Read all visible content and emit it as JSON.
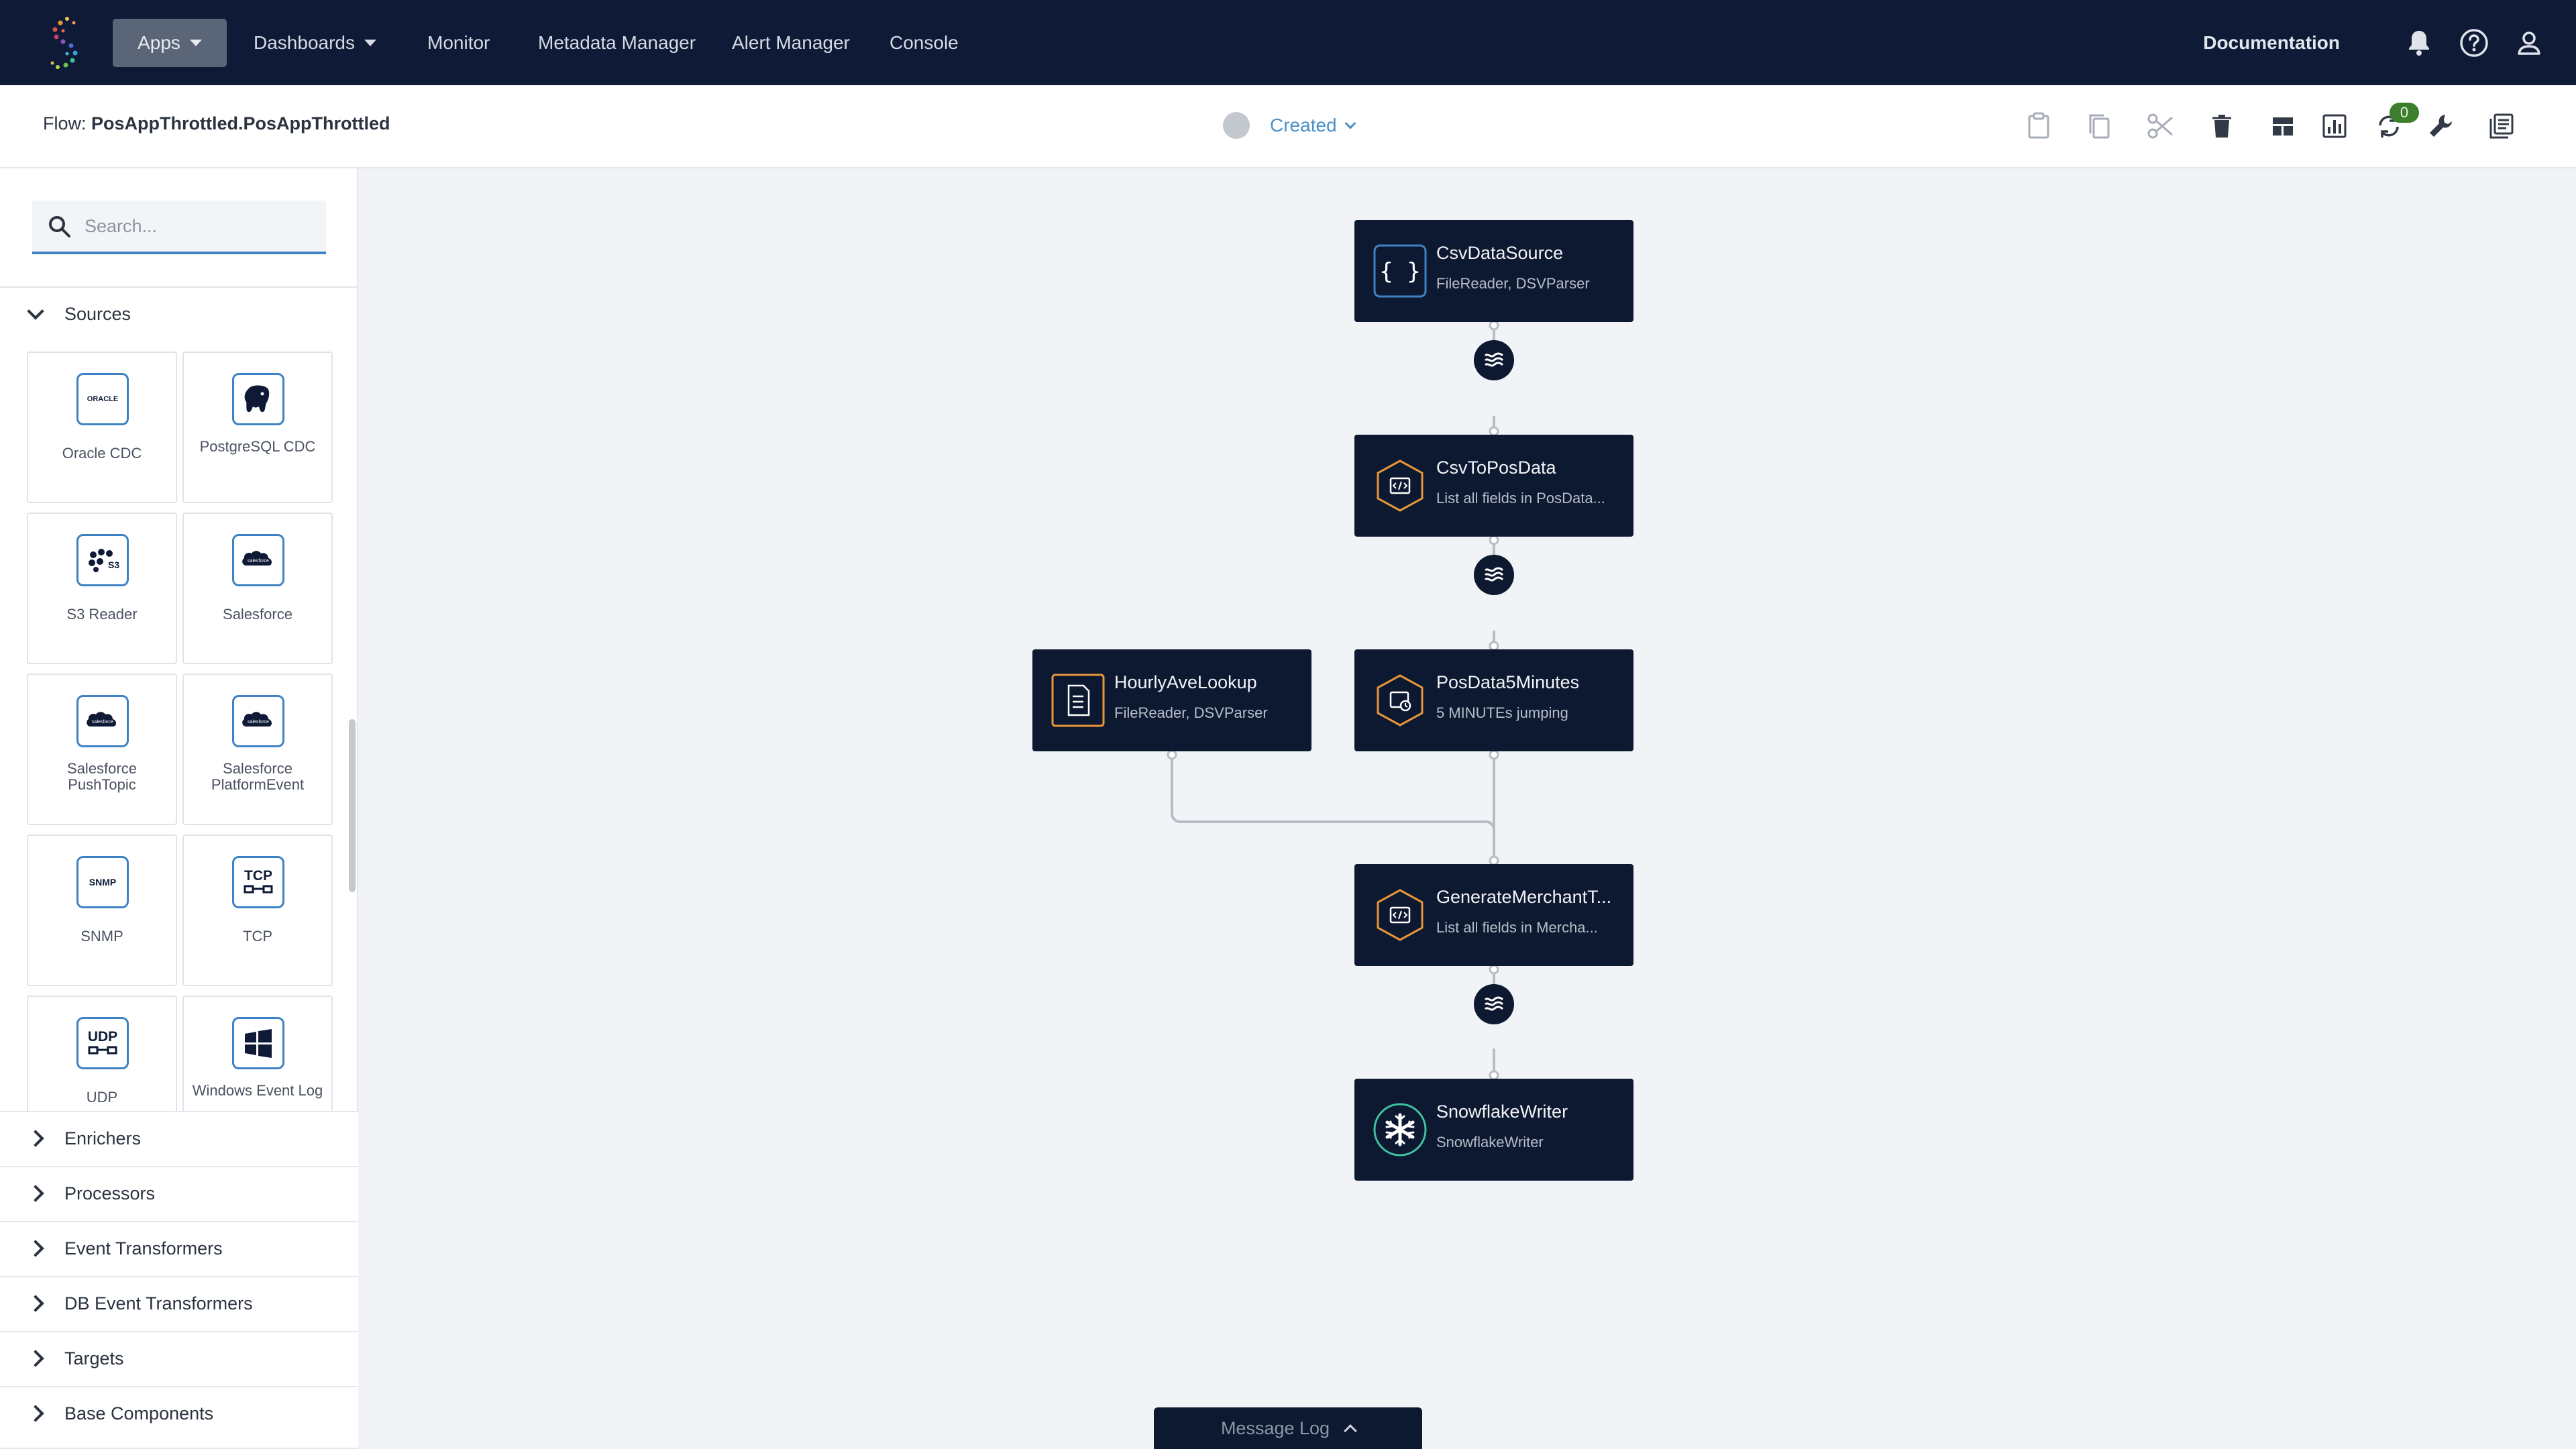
{
  "nav": {
    "apps": "Apps",
    "dashboards": "Dashboards",
    "monitor": "Monitor",
    "metadata_manager": "Metadata Manager",
    "alert_manager": "Alert Manager",
    "console": "Console",
    "documentation": "Documentation"
  },
  "flow": {
    "prefix": "Flow: ",
    "name": "PosAppThrottled.PosAppThrottled",
    "status": "Created",
    "badge_count": "0"
  },
  "sidebar": {
    "search_placeholder": "Search...",
    "sources_label": "Sources",
    "tiles": [
      {
        "label": "Oracle CDC",
        "icon": "oracle-icon",
        "icon_text": "ORACLE"
      },
      {
        "label": "PostgreSQL CDC",
        "icon": "postgresql-icon"
      },
      {
        "label": "S3 Reader",
        "icon": "s3-icon"
      },
      {
        "label": "Salesforce",
        "icon": "salesforce-icon",
        "icon_text": "salesforce"
      },
      {
        "label": "Salesforce PushTopic",
        "icon": "salesforce-icon",
        "icon_text": "salesforce"
      },
      {
        "label": "Salesforce PlatformEvent",
        "icon": "salesforce-icon",
        "icon_text": "salesforce"
      },
      {
        "label": "SNMP",
        "icon": "snmp-icon",
        "icon_text": "SNMP"
      },
      {
        "label": "TCP",
        "icon": "tcp-icon",
        "icon_text": "TCP"
      },
      {
        "label": "UDP",
        "icon": "udp-icon",
        "icon_text": "UDP"
      },
      {
        "label": "Windows Event Log",
        "icon": "windows-icon"
      }
    ],
    "categories": [
      "Enrichers",
      "Processors",
      "Event Transformers",
      "DB Event Transformers",
      "Targets",
      "Base Components"
    ]
  },
  "nodes": {
    "csv_data_source": {
      "title": "CsvDataSource",
      "subtitle": "FileReader, DSVParser"
    },
    "csv_to_pos_data": {
      "title": "CsvToPosData",
      "subtitle": "List all fields in PosData..."
    },
    "hourly_ave_lookup": {
      "title": "HourlyAveLookup",
      "subtitle": "FileReader, DSVParser"
    },
    "pos_data_5_minutes": {
      "title": "PosData5Minutes",
      "subtitle": "5 MINUTEs jumping"
    },
    "generate_merchant": {
      "title": "GenerateMerchantT...",
      "subtitle": "List all fields in Mercha..."
    },
    "snowflake_writer": {
      "title": "SnowflakeWriter",
      "subtitle": "SnowflakeWriter"
    }
  },
  "message_log": "Message Log",
  "colors": {
    "nav_bg": "#0e1a36",
    "node_bg": "#0d1930",
    "accent_blue": "#3e82c4",
    "accent_orange": "#e8963a",
    "badge_green": "#3d7f2d"
  }
}
